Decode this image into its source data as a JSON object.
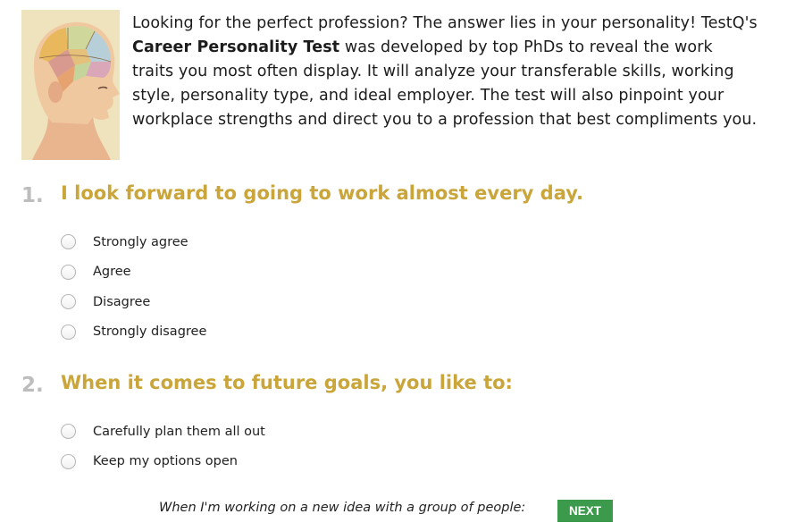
{
  "intro": {
    "image_icon": "phrenology-head-illustration",
    "text_before": "Looking for the perfect profession? The answer lies in your personality! TestQ's ",
    "text_bold": "Career Personality Test",
    "text_after": " was developed by top PhDs to reveal the work traits you most often display. It will analyze your transferable skills, working style, personality type, and ideal employer. The test will also pinpoint your workplace strengths and direct you to a profession that best compliments you."
  },
  "questions": [
    {
      "number": "1.",
      "text": "I look forward to going to work almost every day.",
      "options": [
        "Strongly agree",
        "Agree",
        "Disagree",
        "Strongly disagree"
      ]
    },
    {
      "number": "2.",
      "text": "When it comes to future goals, you like to:",
      "options": [
        "Carefully plan them all out",
        "Keep my options open"
      ]
    }
  ],
  "footer": {
    "prompt": "When I'm working on a new idea with a group of people:",
    "next_label": "NEXT"
  },
  "colors": {
    "question_text": "#c9a53a",
    "question_number": "#bdbdbd",
    "next_button": "#3c9a4c"
  }
}
